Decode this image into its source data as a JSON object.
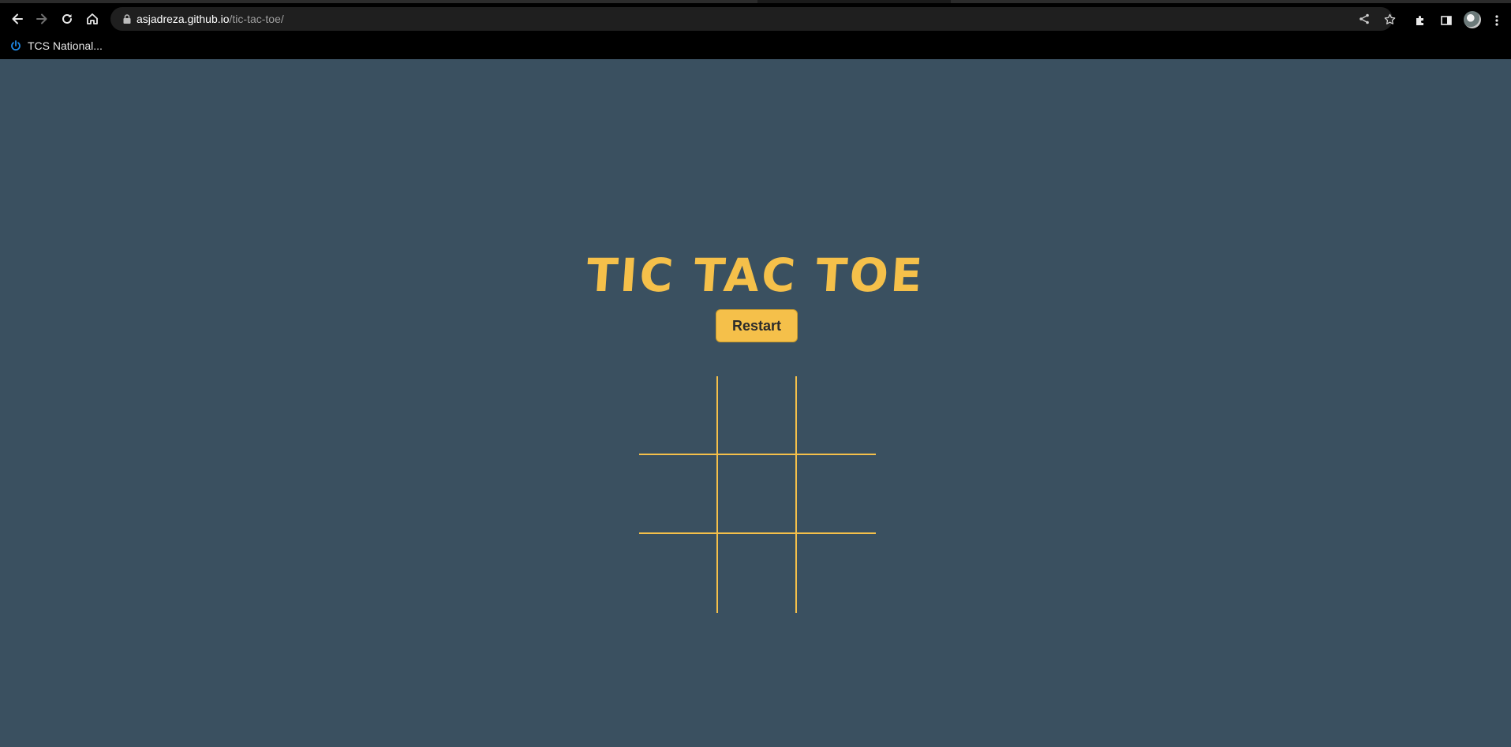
{
  "browser": {
    "url_host": "asjadreza.github.io",
    "url_path": "/tic-tac-toe/",
    "bookmarks": [
      {
        "label": "TCS National..."
      }
    ],
    "icons": {
      "back": "arrow-left-icon",
      "forward": "arrow-right-icon",
      "reload": "reload-icon",
      "home": "home-icon",
      "lock": "lock-icon",
      "share": "share-icon",
      "bookmark_star": "star-icon",
      "extensions": "puzzle-icon",
      "side_panel": "side-panel-icon",
      "menu": "kebab-menu-icon"
    }
  },
  "page": {
    "title": "TIC TAC TOE",
    "restart_label": "Restart",
    "accent_color": "#f5c04a",
    "background_color": "#3a5060",
    "board": [
      [
        "",
        "",
        ""
      ],
      [
        "",
        "",
        ""
      ],
      [
        "",
        "",
        ""
      ]
    ]
  }
}
